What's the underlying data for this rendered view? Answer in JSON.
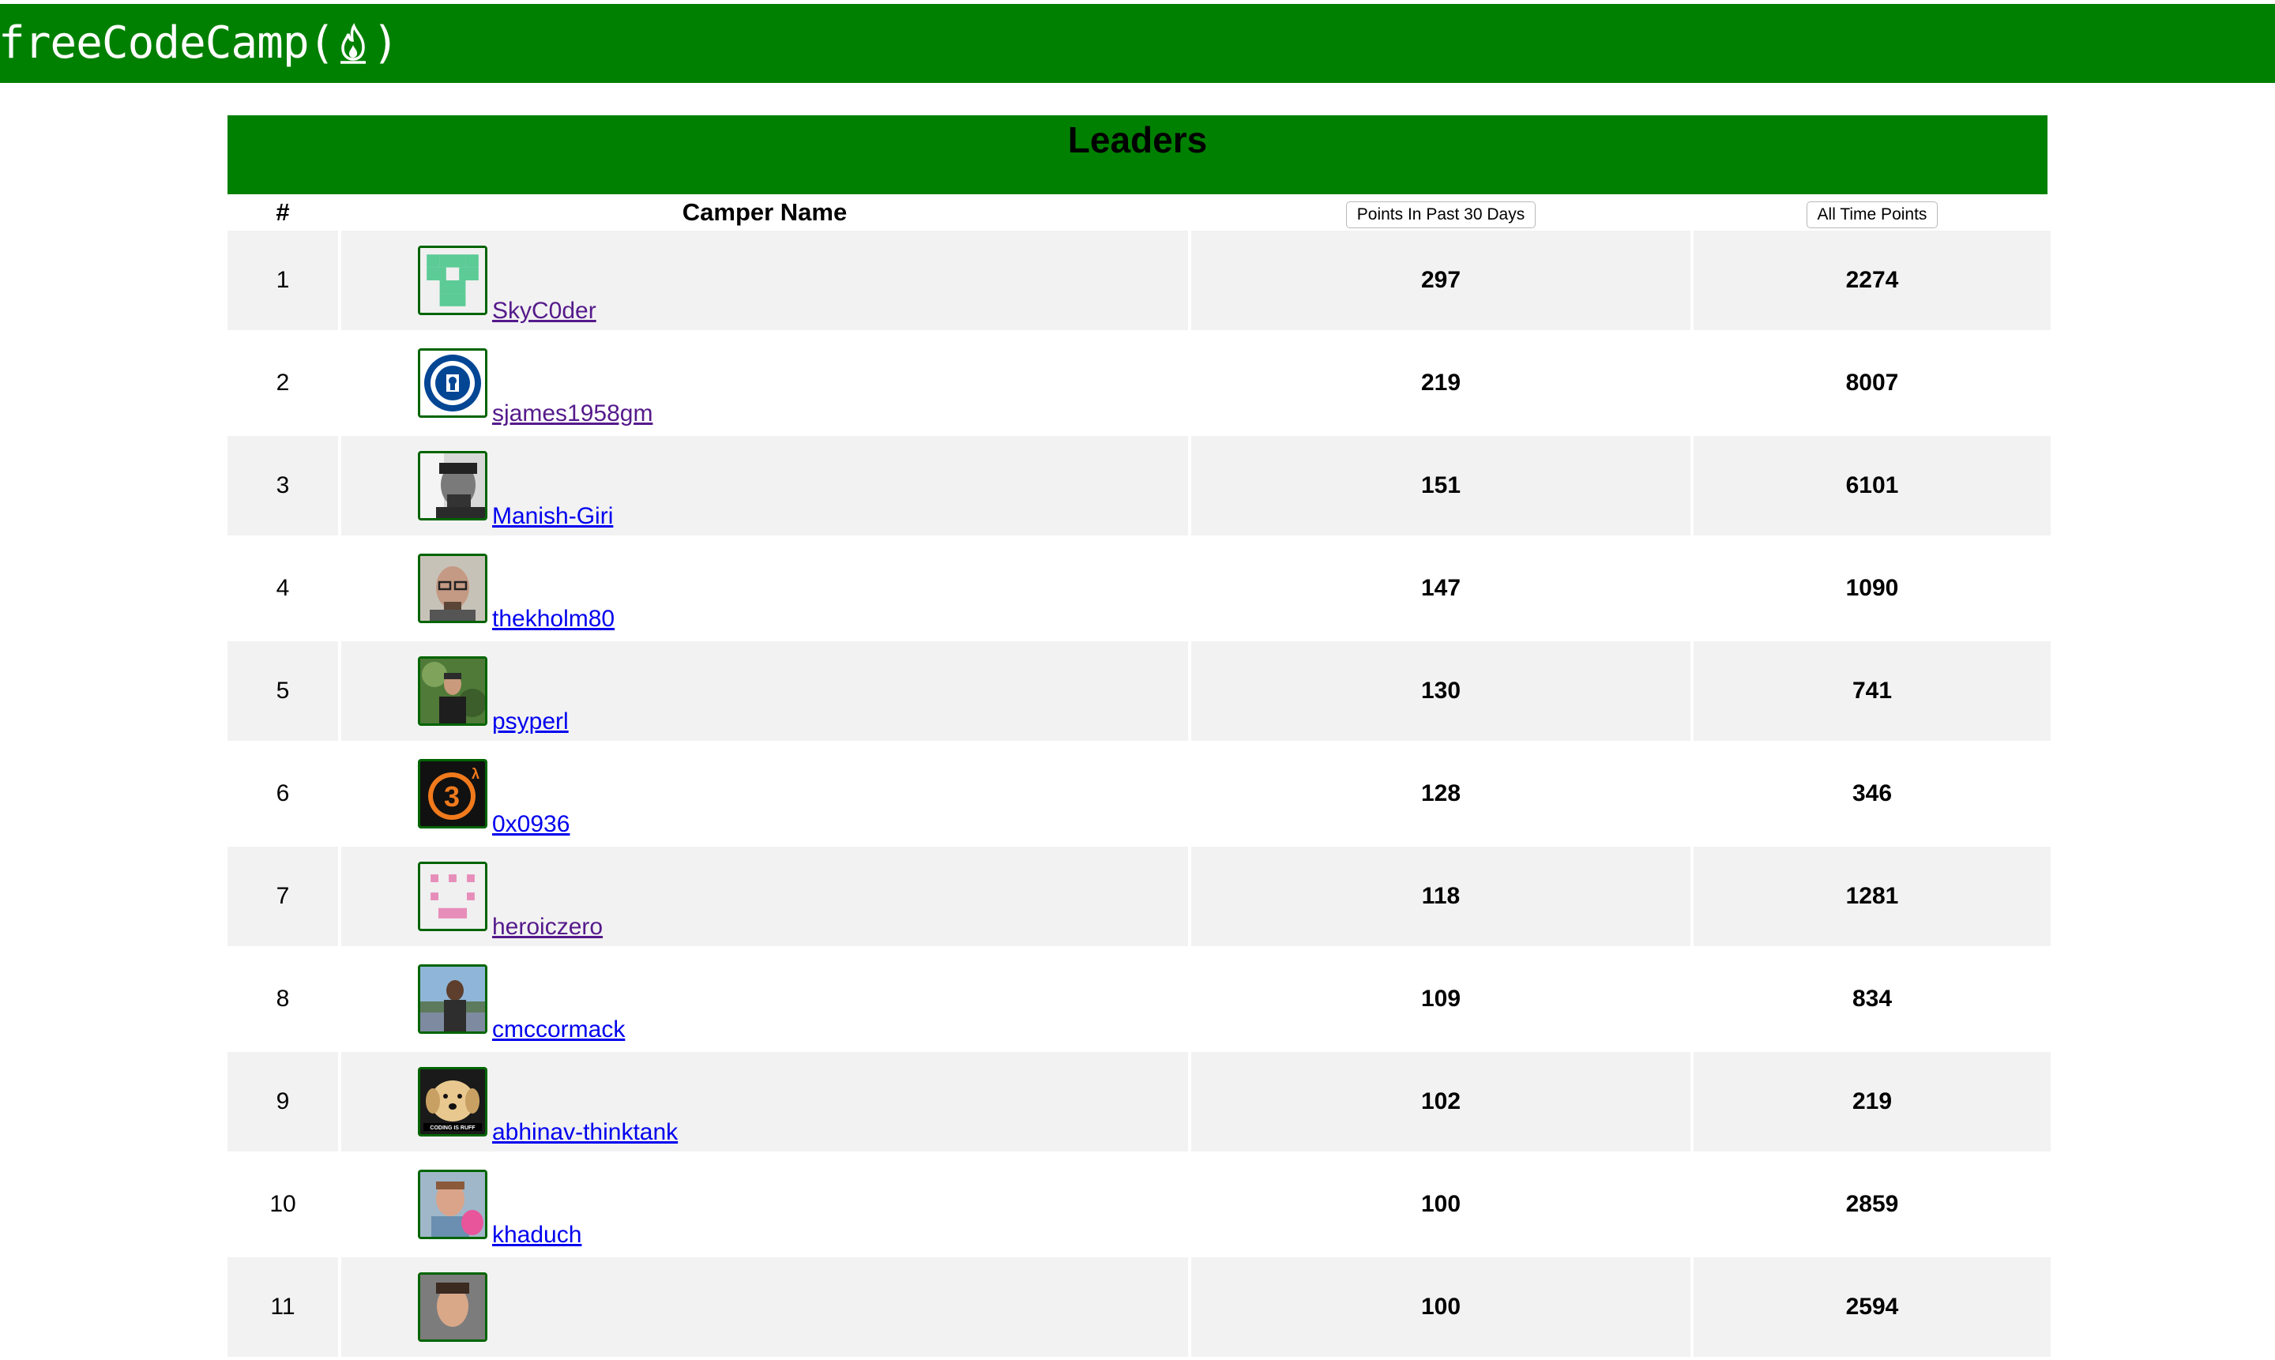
{
  "header": {
    "brand": "freeCodeCamp(",
    "brand_close": ")",
    "bar_color": "#008000"
  },
  "board": {
    "title": "Leaders",
    "columns": {
      "rank": "#",
      "name": "Camper Name",
      "recent": "Points In Past 30 Days",
      "alltime": "All Time Points"
    }
  },
  "campers": [
    {
      "rank": "1",
      "name": "SkyC0der",
      "recent": "297",
      "alltime": "2274",
      "avatar": "pixel-identicon-green",
      "visited": true
    },
    {
      "rank": "2",
      "name": "sjames1958gm",
      "recent": "219",
      "alltime": "8007",
      "avatar": "chelsea-crest",
      "visited": true
    },
    {
      "rank": "3",
      "name": "Manish-Giri",
      "recent": "151",
      "alltime": "6101",
      "avatar": "photo-bw-portrait",
      "visited": false
    },
    {
      "rank": "4",
      "name": "thekholm80",
      "recent": "147",
      "alltime": "1090",
      "avatar": "photo-portrait-glasses",
      "visited": false
    },
    {
      "rank": "5",
      "name": "psyperl",
      "recent": "130",
      "alltime": "741",
      "avatar": "photo-outdoor",
      "visited": false
    },
    {
      "rank": "6",
      "name": "0x0936",
      "recent": "128",
      "alltime": "346",
      "avatar": "half-life-3-logo",
      "visited": false
    },
    {
      "rank": "7",
      "name": "heroiczero",
      "recent": "118",
      "alltime": "1281",
      "avatar": "pixel-identicon-pink",
      "visited": true
    },
    {
      "rank": "8",
      "name": "cmccormack",
      "recent": "109",
      "alltime": "834",
      "avatar": "photo-landscape",
      "visited": false
    },
    {
      "rank": "9",
      "name": "abhinav-thinktank",
      "recent": "102",
      "alltime": "219",
      "avatar": "photo-dog",
      "visited": false
    },
    {
      "rank": "10",
      "name": "khaduch",
      "recent": "100",
      "alltime": "2859",
      "avatar": "photo-portrait-pink",
      "visited": false
    },
    {
      "rank": "11",
      "name": "",
      "recent": "100",
      "alltime": "2594",
      "avatar": "photo-portrait",
      "visited": false
    }
  ]
}
